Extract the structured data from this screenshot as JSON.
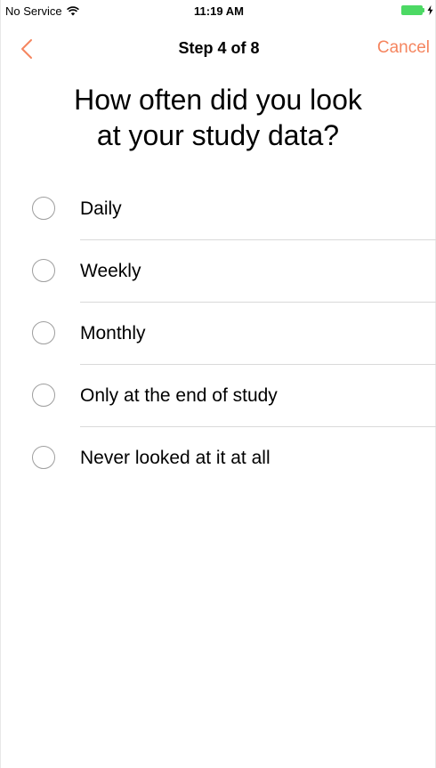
{
  "status_bar": {
    "carrier": "No Service",
    "time": "11:19 AM",
    "wifi_icon": "wifi-icon",
    "battery_icon": "battery-icon",
    "battery_color": "#4cd964",
    "charging_icon": "bolt-icon"
  },
  "nav": {
    "back_icon": "chevron-left-icon",
    "title": "Step 4 of 8",
    "cancel_label": "Cancel",
    "accent_color": "#f5855f"
  },
  "question": {
    "line1": "How often did you look",
    "line2": "at your study data?"
  },
  "options": [
    {
      "label": "Daily",
      "selected": false
    },
    {
      "label": "Weekly",
      "selected": false
    },
    {
      "label": "Monthly",
      "selected": false
    },
    {
      "label": "Only at the end of study",
      "selected": false
    },
    {
      "label": "Never looked at it at all",
      "selected": false
    }
  ]
}
